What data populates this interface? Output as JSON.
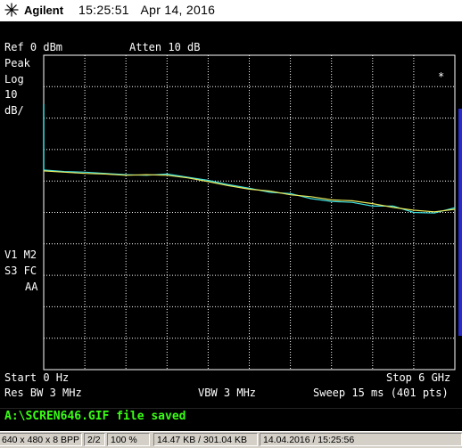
{
  "header": {
    "brand": "Agilent",
    "time": "15:25:51",
    "date": "Apr 14, 2016"
  },
  "settings": {
    "ref": "Ref 0 dBm",
    "atten": "Atten 10 dB",
    "detector": "Peak",
    "scale_type": "Log",
    "scale_value": "10",
    "scale_unit": "dB/",
    "marker_star": "*",
    "status_row1": "V1 M2",
    "status_row2": "S3 FC",
    "status_row3": "AA",
    "start": "Start 0 Hz",
    "stop": "Stop 6 GHz",
    "res_bw": "Res BW 3 MHz",
    "vbw": "VBW 3 MHz",
    "sweep": "Sweep 15 ms (401 pts)"
  },
  "status_message": "A:\\SCREN646.GIF file saved",
  "infobar": {
    "dims": "640 x 480 x 8 BPP",
    "page": "2/2",
    "zoom": "100 %",
    "size": "14.47 KB / 301.04 KB",
    "datetime": "14.04.2016 / 15:25:56"
  },
  "colors": {
    "background": "#000000",
    "grid": "#ffffff",
    "trace1": "#3fe0e0",
    "trace2": "#e6e65a",
    "status_text": "#39ff14"
  },
  "chart_data": {
    "type": "line",
    "xlabel": "",
    "ylabel": "",
    "xlim": [
      0,
      6
    ],
    "ylim": [
      -100,
      0
    ],
    "x": [
      0,
      0.3,
      0.6,
      0.9,
      1.2,
      1.5,
      1.8,
      2.1,
      2.4,
      2.7,
      3.0,
      3.3,
      3.6,
      3.9,
      4.2,
      4.5,
      4.8,
      5.1,
      5.4,
      5.7,
      6.0
    ],
    "series": [
      {
        "color": "cyan",
        "values": [
          -36.5,
          -37.0,
          -37.2,
          -37.6,
          -38.0,
          -38.2,
          -37.8,
          -38.8,
          -39.8,
          -41.2,
          -42.3,
          -43.6,
          -44.0,
          -45.6,
          -46.5,
          -46.8,
          -48.0,
          -48.0,
          -50.0,
          -50.2,
          -48.5
        ]
      },
      {
        "color": "yellow",
        "values": [
          -36.8,
          -37.2,
          -37.6,
          -37.8,
          -38.2,
          -38.0,
          -38.2,
          -39.0,
          -40.2,
          -41.5,
          -42.6,
          -43.2,
          -44.4,
          -45.0,
          -46.0,
          -46.3,
          -47.2,
          -48.4,
          -49.3,
          -49.8,
          -49.0
        ]
      }
    ]
  }
}
